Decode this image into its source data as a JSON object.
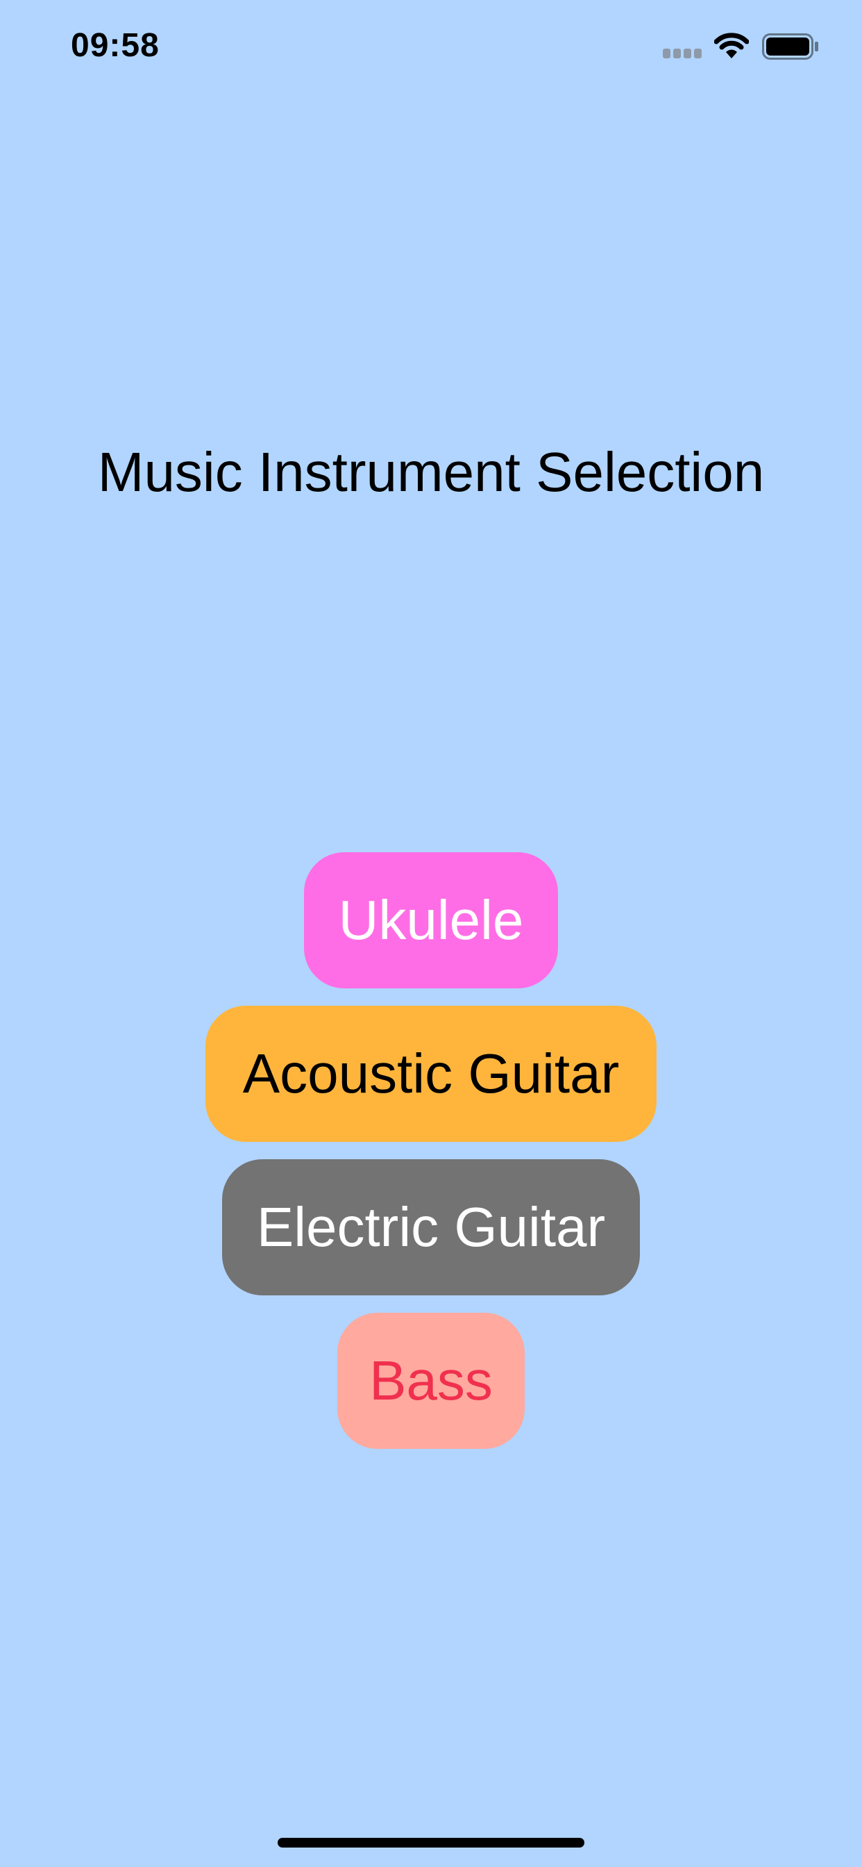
{
  "status_bar": {
    "time": "09:58",
    "icons": [
      "signal-icon",
      "wifi-icon",
      "battery-icon"
    ]
  },
  "title": "Music Instrument Selection",
  "colors": {
    "background": "#B1D5FE",
    "text_dark": "#000000"
  },
  "instruments": [
    {
      "label": "Ukulele",
      "background": "#FF6DE6",
      "text_color": "#FFFFFF"
    },
    {
      "label": "Acoustic Guitar",
      "background": "#FFB53C",
      "text_color": "#000000"
    },
    {
      "label": "Electric Guitar",
      "background": "#737373",
      "text_color": "#FFFFFF"
    },
    {
      "label": "Bass",
      "background": "#FFA99F",
      "text_color": "#F0304E"
    }
  ]
}
